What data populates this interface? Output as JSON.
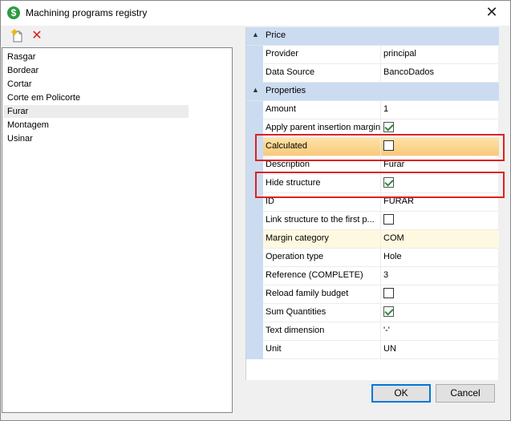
{
  "window": {
    "title": "Machining programs registry",
    "close_glyph": "✕",
    "app_icon_glyph": "$"
  },
  "toolbar": {
    "new_icon": "new-document-icon",
    "delete_icon": "delete-x-icon",
    "delete_glyph": "✕"
  },
  "list": {
    "items": [
      {
        "label": "Rasgar"
      },
      {
        "label": "Bordear"
      },
      {
        "label": "Cortar"
      },
      {
        "label": "Corte em Policorte"
      },
      {
        "label": "Furar",
        "selected": true
      },
      {
        "label": "Montagem"
      },
      {
        "label": "Usinar"
      }
    ]
  },
  "grid": {
    "categories": [
      {
        "label": "Price",
        "toggle": "▲",
        "rows": [
          {
            "name": "Provider",
            "value": "principal"
          },
          {
            "name": "Data Source",
            "value": "BancoDados"
          }
        ]
      },
      {
        "label": "Properties",
        "toggle": "▲",
        "rows": [
          {
            "name": "Amount",
            "value": "1"
          },
          {
            "name": "Apply parent insertion margin",
            "checkbox": true,
            "checked": true
          },
          {
            "name": "Calculated",
            "checkbox": true,
            "checked": false,
            "selected": true
          },
          {
            "name": "Description",
            "value": "Furar"
          },
          {
            "name": "Hide structure",
            "checkbox": true,
            "checked": true
          },
          {
            "name": "ID",
            "value": "FURAR"
          },
          {
            "name": "Link structure to the first p...",
            "checkbox": true,
            "checked": false
          },
          {
            "name": "Margin category",
            "value": "COM",
            "highlighted": true
          },
          {
            "name": "Operation type",
            "value": "Hole"
          },
          {
            "name": "Reference (COMPLETE)",
            "value": "3"
          },
          {
            "name": "Reload family budget",
            "checkbox": true,
            "checked": false
          },
          {
            "name": "Sum Quantities",
            "checkbox": true,
            "checked": true
          },
          {
            "name": "Text dimension",
            "value": "'-'"
          },
          {
            "name": "Unit",
            "value": "UN"
          }
        ]
      }
    ]
  },
  "buttons": {
    "ok": "OK",
    "cancel": "Cancel"
  },
  "colors": {
    "category_bg": "#cbdcf1",
    "selected_row": "#f9c87a",
    "highlight_row": "#fff8e0",
    "annotation_red": "#e02020",
    "check_green": "#2e8b3d"
  }
}
